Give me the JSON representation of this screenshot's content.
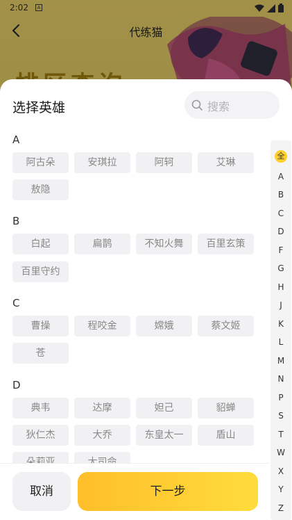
{
  "status_bar": {
    "time": "2:02",
    "sim_glyph": "A"
  },
  "topbar": {
    "title": "代练猫"
  },
  "background_banner_text": "排区查询",
  "sheet": {
    "title": "选择英雄",
    "search_placeholder": "搜索",
    "groups": [
      {
        "letter": "A",
        "heroes": [
          "阿古朵",
          "安琪拉",
          "阿轲",
          "艾琳",
          "敖隐"
        ]
      },
      {
        "letter": "B",
        "heroes": [
          "白起",
          "扁鹊",
          "不知火舞",
          "百里玄策",
          "百里守约"
        ]
      },
      {
        "letter": "C",
        "heroes": [
          "曹操",
          "程咬金",
          "嫦娥",
          "蔡文姬",
          "苍"
        ]
      },
      {
        "letter": "D",
        "heroes": [
          "典韦",
          "达摩",
          "妲己",
          "貂蝉",
          "狄仁杰",
          "大乔",
          "东皇太一",
          "盾山",
          "朵莉亚",
          "大司命"
        ]
      }
    ],
    "index": {
      "all": "全",
      "letters": [
        "A",
        "B",
        "C",
        "D",
        "F",
        "G",
        "H",
        "J",
        "K",
        "L",
        "M",
        "N",
        "P",
        "S",
        "T",
        "W",
        "X",
        "Y",
        "Z"
      ]
    },
    "cancel_label": "取消",
    "next_label": "下一步"
  },
  "colors": {
    "accent": "#ffcf2e",
    "chip_bg": "#f1f1f3"
  }
}
